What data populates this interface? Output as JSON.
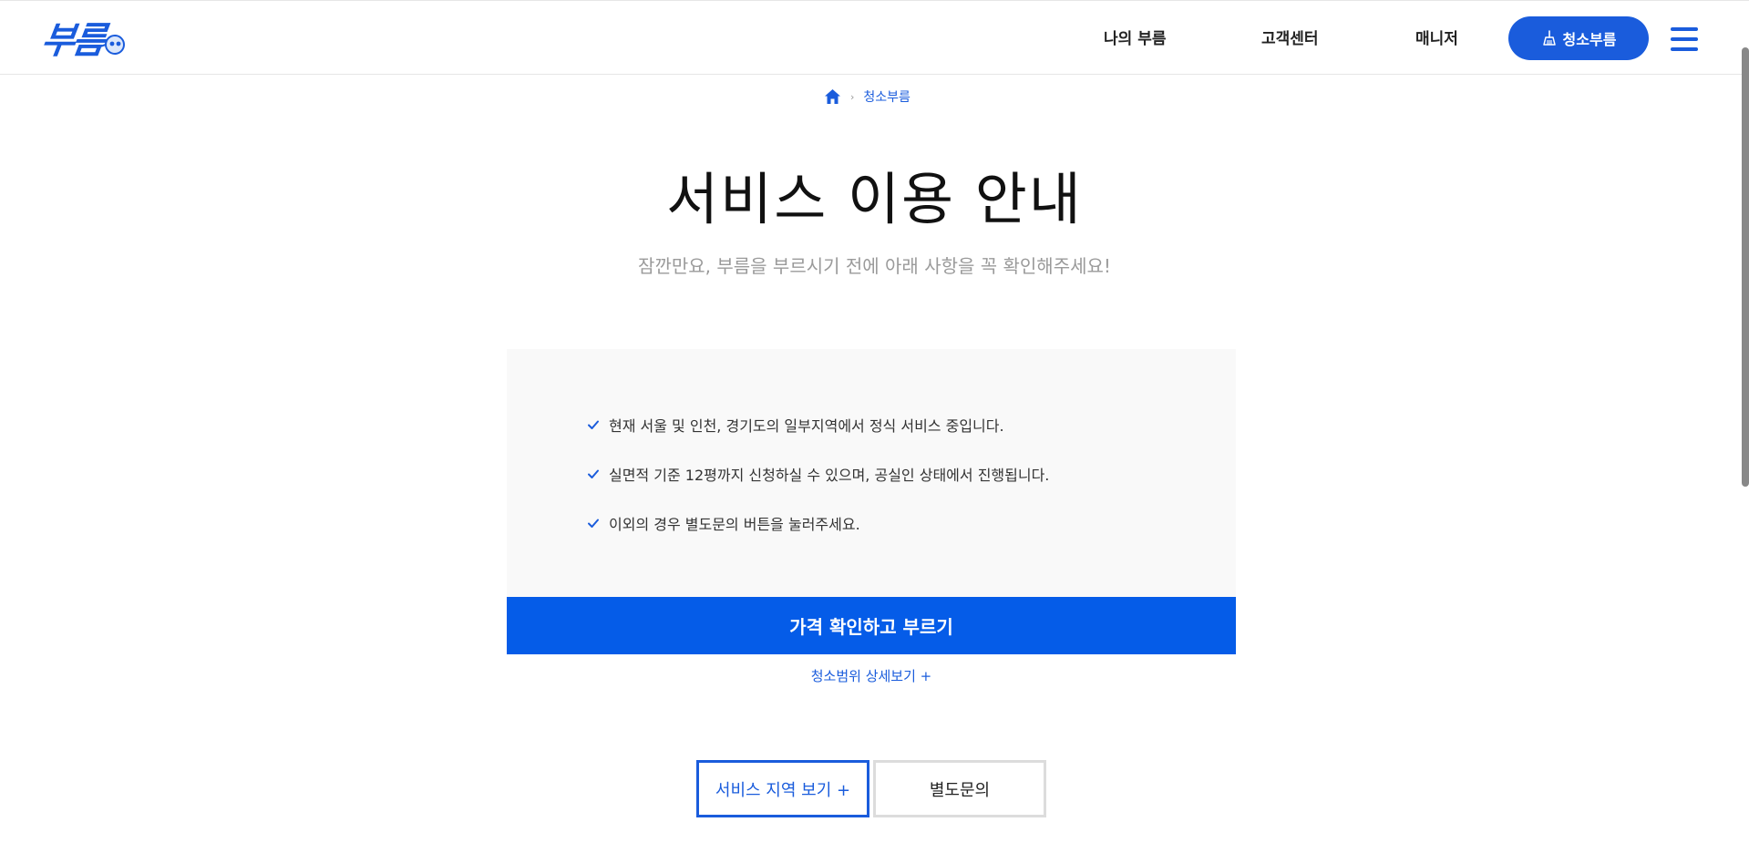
{
  "header": {
    "logo_text": "부름",
    "nav": [
      {
        "label": "나의 부름"
      },
      {
        "label": "고객센터"
      },
      {
        "label": "매니저"
      }
    ],
    "cta_label": "청소부름"
  },
  "breadcrumb": {
    "separator": "›",
    "current": "청소부름"
  },
  "main": {
    "title": "서비스 이용 안내",
    "subtitle": "잠깐만요, 부름을 부르시기 전에 아래 사항을 꼭 확인해주세요!",
    "notices": [
      "현재 서울 및 인천, 경기도의 일부지역에서 정식 서비스 중입니다.",
      "실면적 기준 12평까지 신청하실 수 있으며, 공실인 상태에서 진행됩니다.",
      "이외의 경우 별도문의 버튼을 눌러주세요."
    ],
    "primary_button": "가격 확인하고 부르기",
    "detail_link": "청소범위 상세보기 +",
    "region_button": "서비스 지역 보기 +",
    "inquiry_button": "별도문의"
  },
  "colors": {
    "brand": "#1a5cdc",
    "primary_button": "#055ce8",
    "info_background": "#f9f9f9"
  }
}
